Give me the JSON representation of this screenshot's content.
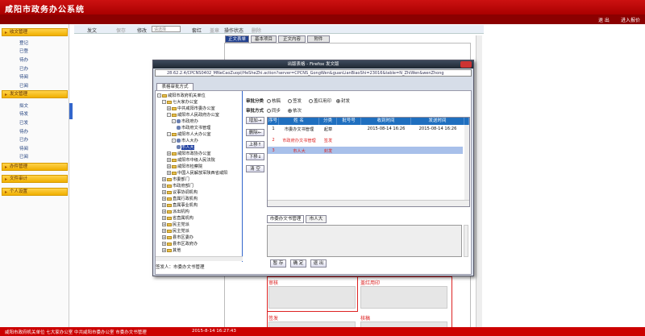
{
  "header": {
    "title": "咸阳市政务办公系统"
  },
  "topbar": {
    "return_label": "退 出",
    "enter_label": "进入报价"
  },
  "sidebar": {
    "sections": [
      {
        "label": "收文管理",
        "items": [
          "登记",
          "已登",
          "待办",
          "已办",
          "待阅",
          "已阅"
        ]
      },
      {
        "label": "发文管理",
        "items": [
          "拟文",
          "待发",
          "已发",
          "待办",
          "已办",
          "待阅",
          "已阅"
        ]
      },
      {
        "label": "办件管理",
        "items": []
      },
      {
        "label": "文件审计",
        "items": []
      },
      {
        "label": "个人设置",
        "items": []
      }
    ]
  },
  "toolbar": {
    "send": "发文",
    "save": "保存",
    "modify": "修改",
    "select_placeholder": "请选择",
    "red_head": "套红",
    "seal": "盖章",
    "log": "操作状态",
    "delete": "删除"
  },
  "doc_tabs": [
    "正文表单",
    "基本项目",
    "正文内容",
    "附件"
  ],
  "doc_form": {
    "label_sign": "审核",
    "label_seal": "盖红用印",
    "label_countersign": "签发",
    "label_draft": "核稿"
  },
  "dialog": {
    "title": "出版表格 - Firefox 发文版",
    "url": "28.62.2.4/CPCNS0402_MNeCaoZuopl/HeSheZhi.action?server=CPCNS_GongWen&guanLianBiaoShi=23016&table=N_ZhiWen&wenZhong",
    "tab": "表格审批方式",
    "tree": [
      {
        "label": "咸阳市政府机关单位",
        "level": 0,
        "kind": "folder",
        "toggle": "-"
      },
      {
        "label": "七大家办公室",
        "level": 1,
        "kind": "folder",
        "toggle": "-"
      },
      {
        "label": "中共咸阳市委办公室",
        "level": 2,
        "kind": "folder",
        "toggle": "+"
      },
      {
        "label": "咸阳市人民政府办公室",
        "level": 2,
        "kind": "folder",
        "toggle": "-"
      },
      {
        "label": "市政府办",
        "level": 3,
        "kind": "person",
        "toggle": "-"
      },
      {
        "label": "市政府文书管理",
        "level": 4,
        "kind": "person",
        "toggle": ""
      },
      {
        "label": "咸阳市人大办公室",
        "level": 2,
        "kind": "folder",
        "toggle": "-"
      },
      {
        "label": "市人大办",
        "level": 3,
        "kind": "person",
        "toggle": "-"
      },
      {
        "label": "市人大",
        "level": 4,
        "kind": "person",
        "toggle": "",
        "selected": true
      },
      {
        "label": "咸阳市政协办公室",
        "level": 2,
        "kind": "folder",
        "toggle": "+"
      },
      {
        "label": "咸阳市中级人民法院",
        "level": 2,
        "kind": "folder",
        "toggle": "+"
      },
      {
        "label": "咸阳市检察院",
        "level": 2,
        "kind": "folder",
        "toggle": "+"
      },
      {
        "label": "中国人民解放军陕西省咸阳",
        "level": 2,
        "kind": "folder",
        "toggle": "+"
      },
      {
        "label": "市委部门",
        "level": 1,
        "kind": "folder",
        "toggle": "+"
      },
      {
        "label": "市政府部门",
        "level": 1,
        "kind": "folder",
        "toggle": "+"
      },
      {
        "label": "议事协调机构",
        "level": 1,
        "kind": "folder",
        "toggle": "+"
      },
      {
        "label": "直属行政机构",
        "level": 1,
        "kind": "folder",
        "toggle": "+"
      },
      {
        "label": "直属事业机构",
        "level": 1,
        "kind": "folder",
        "toggle": "+"
      },
      {
        "label": "派出机构",
        "level": 1,
        "kind": "folder",
        "toggle": "+"
      },
      {
        "label": "省直属机构",
        "level": 1,
        "kind": "folder",
        "toggle": "+"
      },
      {
        "label": "民主党派",
        "level": 1,
        "kind": "folder",
        "toggle": "+"
      },
      {
        "label": "民主党派",
        "level": 1,
        "kind": "folder",
        "toggle": "+"
      },
      {
        "label": "县市区委办",
        "level": 1,
        "kind": "folder",
        "toggle": "+"
      },
      {
        "label": "县市区政府办",
        "level": 1,
        "kind": "folder",
        "toggle": "+"
      },
      {
        "label": "其他",
        "level": 1,
        "kind": "folder",
        "toggle": "+"
      }
    ],
    "signer": "签发人：市委办文书管理",
    "approve_class_label": "审批分类",
    "approve_class_opts": [
      "核稿",
      "签发",
      "盖红用印",
      "封发"
    ],
    "approve_mode_label": "审批方式",
    "approve_mode_opts": [
      "同步",
      "依次"
    ],
    "side_buttons": [
      "增加→",
      "删除←",
      "上移↑",
      "下移↓",
      "清 空"
    ],
    "grid_headers": [
      "序号",
      "姓 名",
      "分类",
      "批号号",
      "收到时间",
      "发送时间"
    ],
    "grid_rows": [
      {
        "seq": "1",
        "name": "市委办文书管理",
        "cls": "起草",
        "num": "",
        "recv": "2015-08-14 16:26",
        "send": "2015-08-14 16:26",
        "color": "#111"
      },
      {
        "seq": "2",
        "name": "市政府办文书管理",
        "cls": "签发",
        "num": "",
        "recv": "",
        "send": "",
        "color": "#d22"
      },
      {
        "seq": "3",
        "name": "市人大",
        "cls": "封发",
        "num": "",
        "recv": "",
        "send": "",
        "color": "#d22"
      }
    ],
    "opinion_tabs": [
      "市委办文书管理",
      "市人大"
    ],
    "action_buttons": [
      "暂 存",
      "确 定",
      "退 出"
    ]
  },
  "statusbar": {
    "text": "咸阳市政府机关单位 七大家办公室 中共咸阳市委办公室 市委办文书管理",
    "time": "2015-8-14 16:27:43"
  }
}
